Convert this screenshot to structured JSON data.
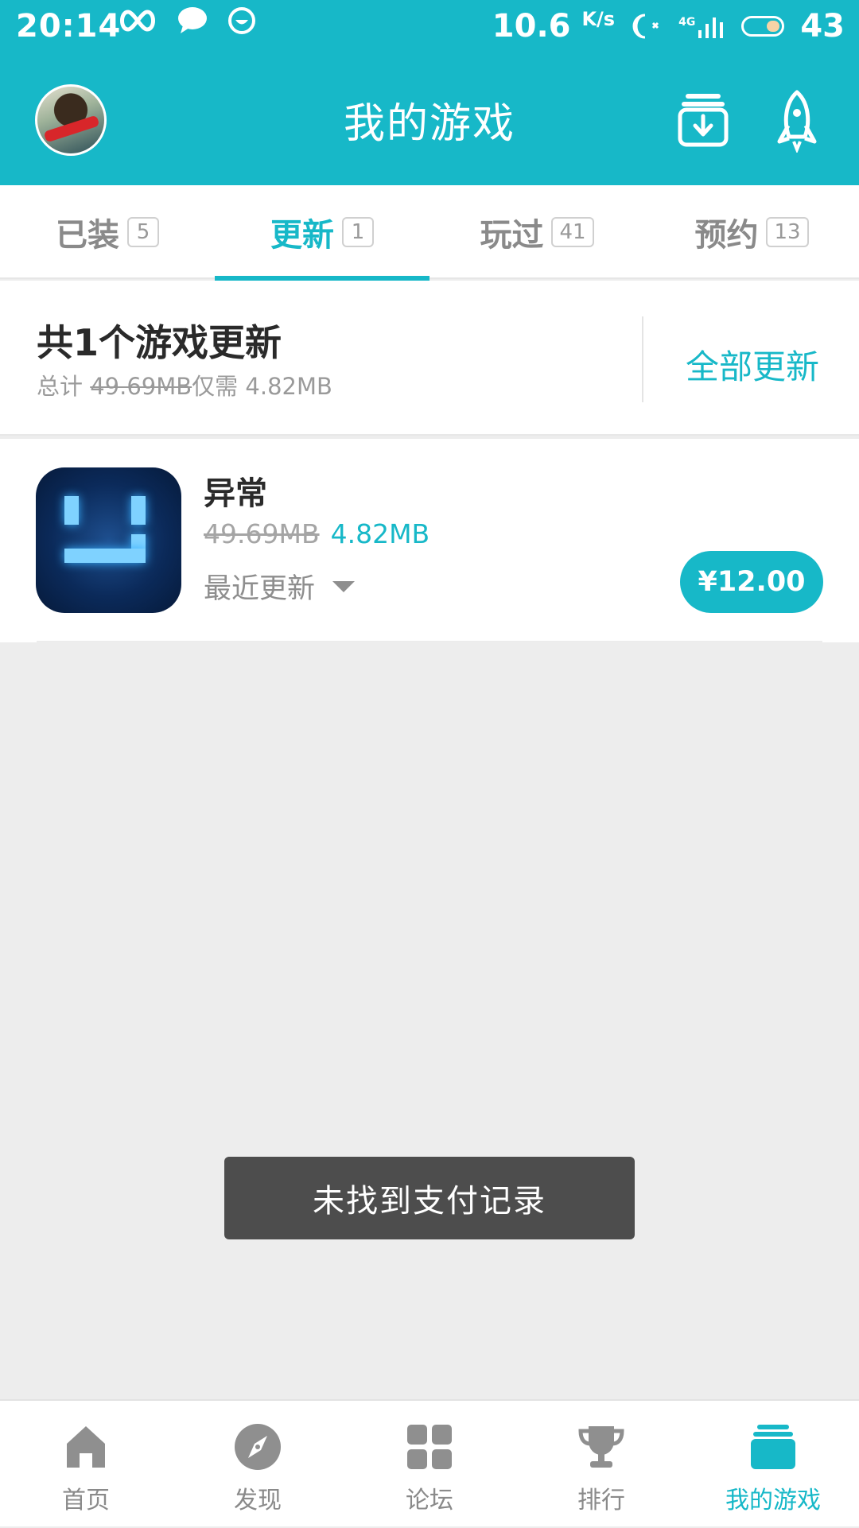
{
  "status_bar": {
    "time": "20:14",
    "network_speed": "10.6",
    "speed_unit": "K/s",
    "signal_label": "4G",
    "battery": "43"
  },
  "header": {
    "title": "我的游戏",
    "icons": [
      "avatar",
      "download-manager-icon",
      "rocket-icon"
    ]
  },
  "tabs": [
    {
      "label": "已装",
      "count": "5"
    },
    {
      "label": "更新",
      "count": "1"
    },
    {
      "label": "玩过",
      "count": "41"
    },
    {
      "label": "预约",
      "count": "13"
    }
  ],
  "active_tab": "更新",
  "summary": {
    "title": "共1个游戏更新",
    "total_prefix": "总计",
    "original_size": "49.69MB",
    "need_text": "仅需",
    "need_size": "4.82MB",
    "update_all": "全部更新"
  },
  "games": [
    {
      "name": "异常",
      "old_size": "49.69MB",
      "new_size": "4.82MB",
      "recent_label": "最近更新",
      "price": "¥12.00"
    }
  ],
  "toast": "未找到支付记录",
  "bottom_nav": [
    {
      "label": "首页",
      "icon": "home-icon"
    },
    {
      "label": "发现",
      "icon": "compass-icon"
    },
    {
      "label": "论坛",
      "icon": "grid-icon"
    },
    {
      "label": "排行",
      "icon": "trophy-icon"
    },
    {
      "label": "我的游戏",
      "icon": "game-stack-icon"
    }
  ],
  "colors": {
    "accent": "#17b8c8",
    "inactive": "#8a8a8a",
    "background": "#ededed"
  }
}
